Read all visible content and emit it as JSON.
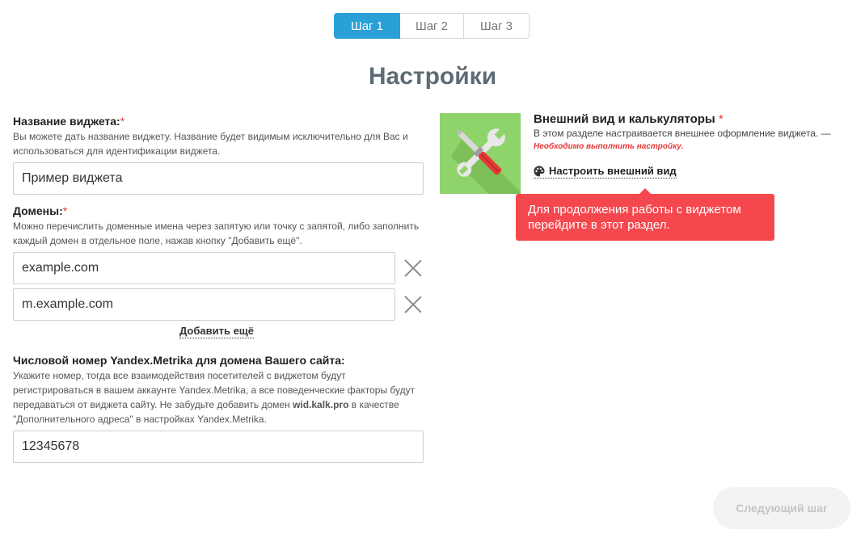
{
  "steps": [
    {
      "label": "Шаг 1",
      "active": true
    },
    {
      "label": "Шаг 2",
      "active": false
    },
    {
      "label": "Шаг 3",
      "active": false
    }
  ],
  "page_title": "Настройки",
  "widget_name": {
    "label": "Название виджета:",
    "required_mark": "*",
    "help": "Вы можете дать название виджету. Название будет видимым исключительно для Вас и использоваться для идентификации виджета.",
    "value": "Пример виджета"
  },
  "domains": {
    "label": "Домены:",
    "required_mark": "*",
    "help": "Можно перечислить доменные имена через запятую или точку с запятой, либо заполнить каждый домен в отдельное поле, нажав кнопку \"Добавить ещё\".",
    "items": [
      "example.com",
      "m.example.com"
    ],
    "add_more_label": "Добавить ещё"
  },
  "metrika": {
    "label": "Числовой номер Yandex.Metrika для домена Вашего сайта:",
    "help_part1": "Укажите номер, тогда все взаимодействия посетителей с виджетом будут регистрироваться в вашем аккаунте Yandex.Metrika, а все поведенческие факторы будут передаваться от виджета сайту. Не забудьте добавить домен ",
    "help_domain": "wid.kalk.pro",
    "help_part2": " в качестве \"Дополнительного адреса\" в настройках Yandex.Metrika.",
    "value": "12345678"
  },
  "appearance": {
    "title": "Внешний вид и калькуляторы",
    "required_mark": "*",
    "description": "В этом разделе настраивается внешнее оформление виджета. —",
    "warning": "Необходимо выполнить настройку.",
    "config_link": "Настроить внешний вид",
    "icon": "tools-icon"
  },
  "tooltip": {
    "text": "Для продолжения работы с виджетом перейдите в этот раздел."
  },
  "next_button": "Следующий шаг",
  "colors": {
    "accent": "#2aa0d8",
    "tile": "#8fd36b",
    "error": "#e53935",
    "tooltip": "#f5474e"
  }
}
